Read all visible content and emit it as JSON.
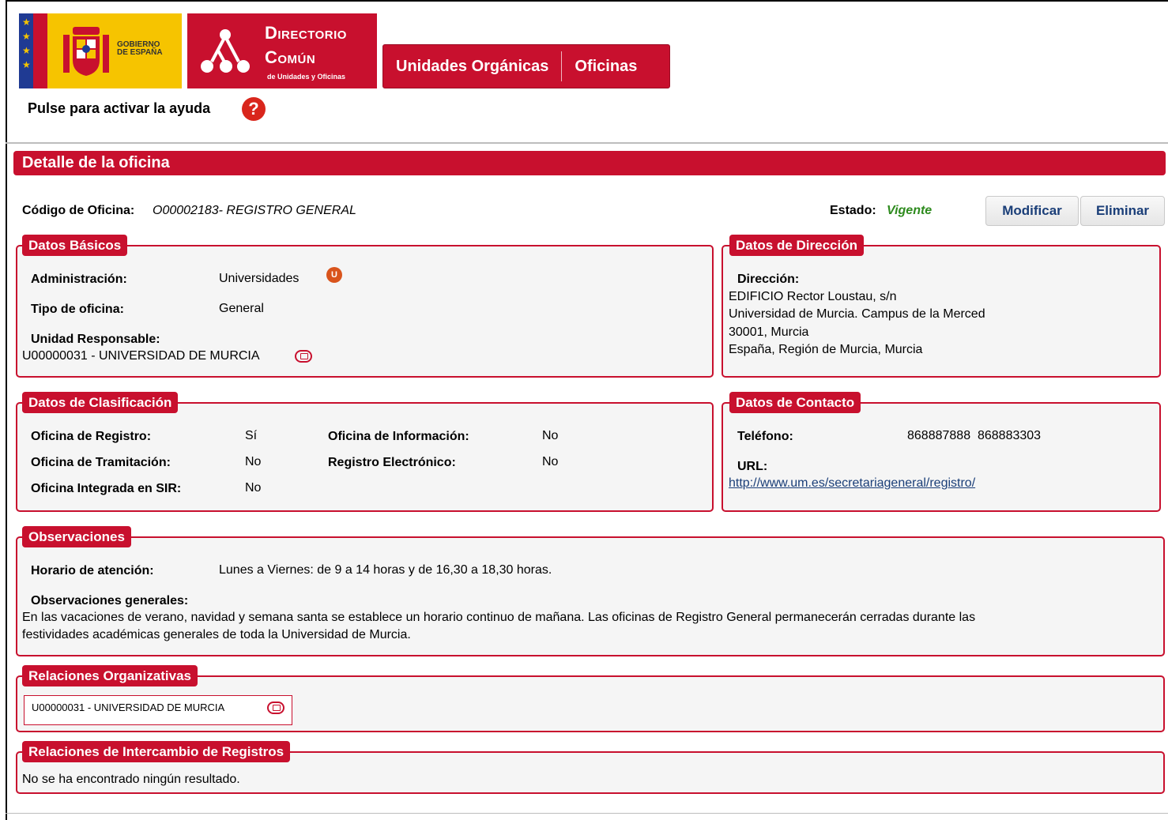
{
  "header": {
    "gobierno_line1": "GOBIERNO",
    "gobierno_line2": "DE ESPAÑA",
    "dc_title1": "Directorio",
    "dc_title2": "Común",
    "dc_subtitle": "de Unidades y Oficinas",
    "nav": [
      "Unidades Orgánicas",
      "Oficinas"
    ],
    "help_text": "Pulse para activar la ayuda",
    "help_icon": "?"
  },
  "page": {
    "title": "Detalle de la oficina",
    "code_label": "Código de Oficina:",
    "code_value": "O00002183- REGISTRO GENERAL",
    "estado_label": "Estado:",
    "estado_value": "Vigente",
    "modify_button": "Modificar",
    "delete_button": "Eliminar"
  },
  "datos_basicos": {
    "legend": "Datos Básicos",
    "administracion_label": "Administración:",
    "administracion_value": "Universidades",
    "administracion_badge": "U",
    "tipo_label": "Tipo de oficina:",
    "tipo_value": "General",
    "unidad_label": "Unidad Responsable:",
    "unidad_value": "U00000031 - UNIVERSIDAD DE MURCIA"
  },
  "datos_direccion": {
    "legend": "Datos de Dirección",
    "label": "Dirección:",
    "line1": "EDIFICIO Rector Loustau, s/n",
    "line2": "Universidad de Murcia. Campus de la Merced",
    "line3": "30001, Murcia",
    "line4": "España, Región de Murcia, Murcia"
  },
  "datos_clasificacion": {
    "legend": "Datos de Clasificación",
    "registro_label": "Oficina de Registro:",
    "registro_value": "Sí",
    "tramitacion_label": "Oficina de Tramitación:",
    "tramitacion_value": "No",
    "sir_label": "Oficina Integrada en SIR:",
    "sir_value": "No",
    "informacion_label": "Oficina de Información:",
    "informacion_value": "No",
    "electronico_label": "Registro Electrónico:",
    "electronico_value": "No"
  },
  "datos_contacto": {
    "legend": "Datos de Contacto",
    "telefono_label": "Teléfono:",
    "telefono_value": "868887888  868883303",
    "url_label": "URL:",
    "url_value": "http://www.um.es/secretariageneral/registro/"
  },
  "observaciones": {
    "legend": "Observaciones",
    "horario_label": "Horario de atención:",
    "horario_value": "Lunes a Viernes: de 9 a 14 horas y de 16,30 a 18,30 horas.",
    "generales_label": "Observaciones generales:",
    "generales_line1": "En las vacaciones de verano, navidad y semana santa se establece un horario continuo de mañana. Las oficinas de Registro General permanecerán cerradas durante las",
    "generales_line2": "festividades académicas generales de toda la Universidad de Murcia."
  },
  "relaciones_organizativas": {
    "legend": "Relaciones Organizativas",
    "item": "U00000031 - UNIVERSIDAD DE MURCIA"
  },
  "relaciones_intercambio": {
    "legend": "Relaciones de Intercambio de Registros",
    "empty": "No se ha encontrado ningún resultado."
  }
}
